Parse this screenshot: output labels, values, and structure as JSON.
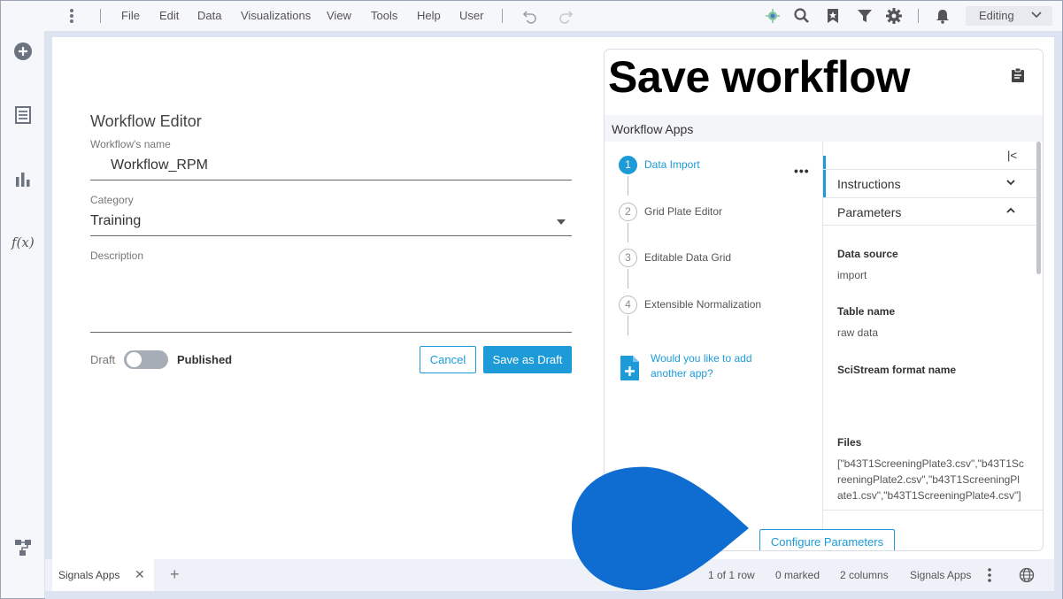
{
  "menubar": {
    "items": [
      "File",
      "Edit",
      "Data",
      "Visualizations",
      "View",
      "Tools",
      "Help",
      "User"
    ],
    "mode": "Editing"
  },
  "sidebar": {
    "fx_label": "f(x)"
  },
  "form": {
    "title": "Workflow Editor",
    "name_label": "Workflow's name",
    "name_value": "Workflow_RPM",
    "category_label": "Category",
    "category_value": "Training",
    "description_label": "Description",
    "toggle_off_label": "Draft",
    "toggle_on_label": "Published",
    "toggle_on": false,
    "cancel_label": "Cancel",
    "save_draft_label": "Save as Draft"
  },
  "panel": {
    "title": "Save workflow",
    "apps_header": "Workflow Apps",
    "steps": [
      {
        "num": "1",
        "label": "Data Import",
        "active": true
      },
      {
        "num": "2",
        "label": "Grid Plate Editor",
        "active": false
      },
      {
        "num": "3",
        "label": "Editable Data Grid",
        "active": false
      },
      {
        "num": "4",
        "label": "Extensible Normalization",
        "active": false
      }
    ],
    "step_menu": "•••",
    "add_app_line1": "Would you like to add",
    "add_app_line2": "another app?",
    "collapse_glyph": "|<",
    "instructions_label": "Instructions",
    "parameters_label": "Parameters",
    "fields": [
      {
        "label": "Data source",
        "value": "import"
      },
      {
        "label": "Table name",
        "value": "raw data"
      },
      {
        "label": "SciStream format name",
        "value": ""
      },
      {
        "label": "Files",
        "value": "[\"b43T1ScreeningPlate3.csv\",\"b43T1ScreeningPlate2.csv\",\"b43T1ScreeningPlate1.csv\",\"b43T1ScreeningPlate4.csv\"]"
      }
    ],
    "configure_label": "Configure Parameters"
  },
  "statusbar": {
    "tab_label": "Signals Apps",
    "tab_close": "✕",
    "tab_add": "+",
    "rows": "1 of 1 row",
    "marked": "0 marked",
    "columns": "2 columns",
    "app": "Signals Apps"
  },
  "colors": {
    "accent": "#1c9bd8",
    "callout": "#0f6dd1"
  }
}
